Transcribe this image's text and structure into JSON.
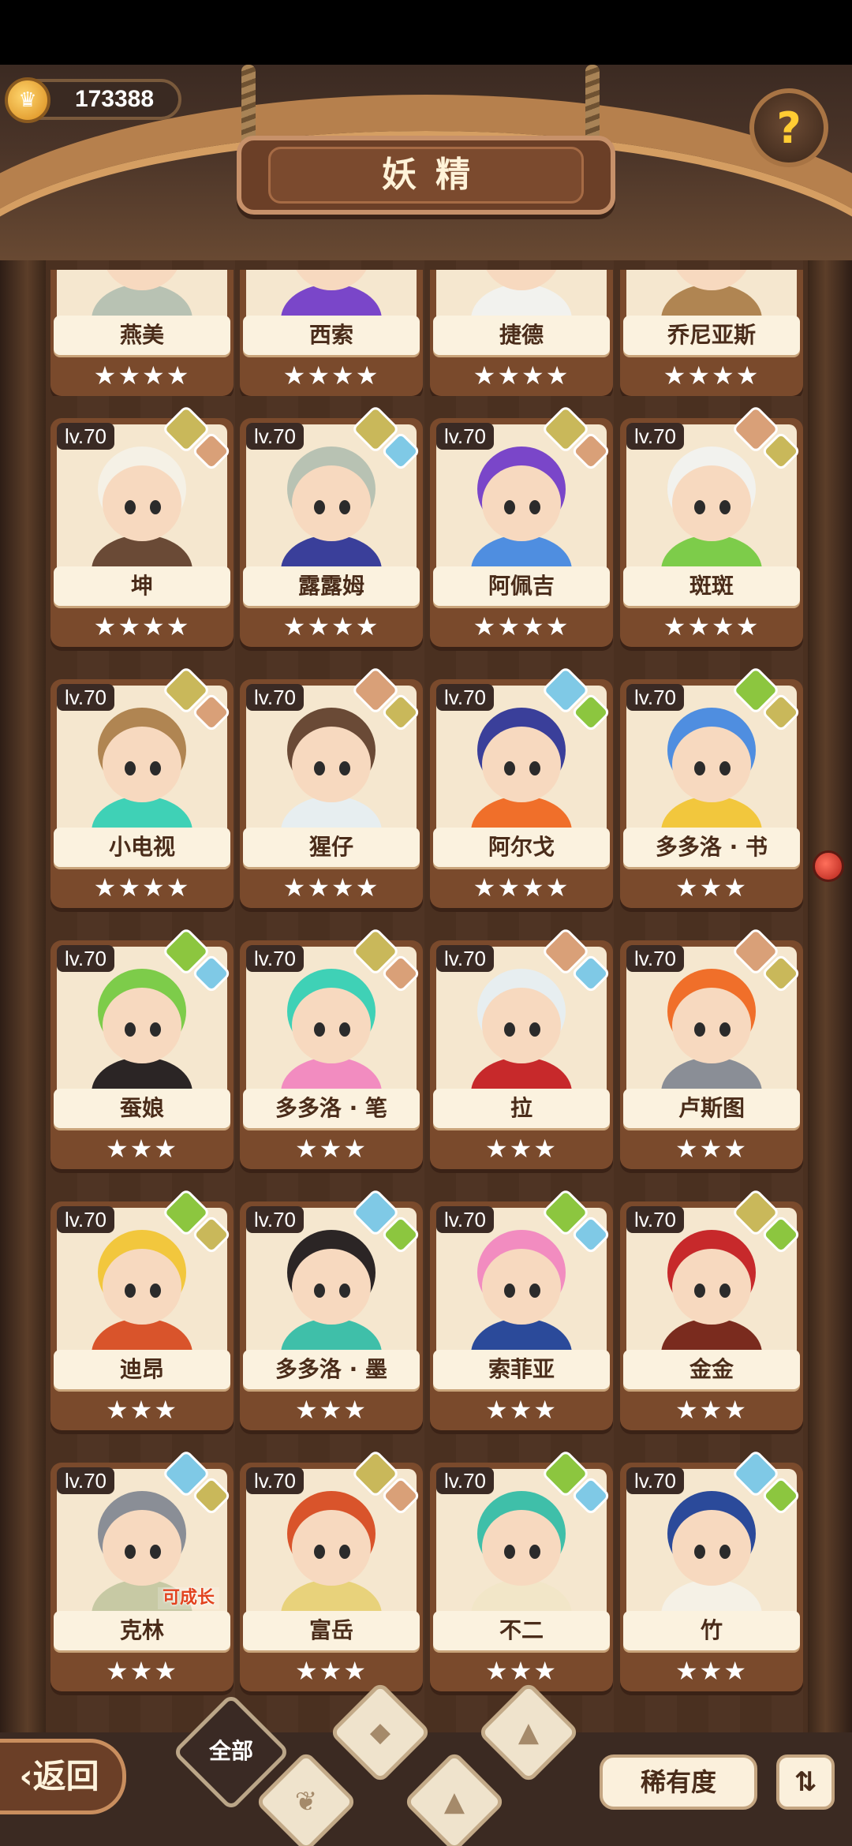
{
  "header": {
    "coins": "173388",
    "title": "妖精"
  },
  "bottom": {
    "back_label": "返回",
    "filter_all": "全部",
    "rarity_label": "稀有度"
  },
  "colors": {
    "element_leaf": "#8cc63f",
    "element_water": "#7fc9e6",
    "element_earth": "#c9b85a",
    "element_fire": "#d9a078"
  },
  "fairies": [
    {
      "name": "燕美",
      "level": "",
      "stars": "★★★★",
      "badges": []
    },
    {
      "name": "西索",
      "level": "",
      "stars": "★★★★",
      "badges": []
    },
    {
      "name": "捷德",
      "level": "",
      "stars": "★★★★",
      "badges": []
    },
    {
      "name": "乔尼亚斯",
      "level": "",
      "stars": "★★★★",
      "badges": []
    },
    {
      "name": "坤",
      "level": "lv.70",
      "stars": "★★★★",
      "badges": [
        "earth",
        "fire"
      ]
    },
    {
      "name": "露露姆",
      "level": "lv.70",
      "stars": "★★★★",
      "badges": [
        "earth",
        "water"
      ]
    },
    {
      "name": "阿佩吉",
      "level": "lv.70",
      "stars": "★★★★",
      "badges": [
        "earth",
        "fire"
      ]
    },
    {
      "name": "斑斑",
      "level": "lv.70",
      "stars": "★★★★",
      "badges": [
        "fire",
        "earth"
      ]
    },
    {
      "name": "小电视",
      "level": "lv.70",
      "stars": "★★★★",
      "badges": [
        "earth",
        "fire"
      ]
    },
    {
      "name": "猩仔",
      "level": "lv.70",
      "stars": "★★★★",
      "badges": [
        "fire",
        "earth"
      ]
    },
    {
      "name": "阿尔戈",
      "level": "lv.70",
      "stars": "★★★★",
      "badges": [
        "water",
        "leaf"
      ]
    },
    {
      "name": "多多洛 · 书",
      "level": "lv.70",
      "stars": "★★★",
      "badges": [
        "leaf",
        "earth"
      ]
    },
    {
      "name": "蚕娘",
      "level": "lv.70",
      "stars": "★★★",
      "badges": [
        "leaf",
        "water"
      ]
    },
    {
      "name": "多多洛 · 笔",
      "level": "lv.70",
      "stars": "★★★",
      "badges": [
        "earth",
        "fire"
      ]
    },
    {
      "name": "拉",
      "level": "lv.70",
      "stars": "★★★",
      "badges": [
        "fire",
        "water"
      ]
    },
    {
      "name": "卢斯图",
      "level": "lv.70",
      "stars": "★★★",
      "badges": [
        "fire",
        "earth"
      ]
    },
    {
      "name": "迪昂",
      "level": "lv.70",
      "stars": "★★★",
      "badges": [
        "leaf",
        "earth"
      ]
    },
    {
      "name": "多多洛 · 墨",
      "level": "lv.70",
      "stars": "★★★",
      "badges": [
        "water",
        "leaf"
      ]
    },
    {
      "name": "索菲亚",
      "level": "lv.70",
      "stars": "★★★",
      "badges": [
        "leaf",
        "water"
      ]
    },
    {
      "name": "金金",
      "level": "lv.70",
      "stars": "★★★",
      "badges": [
        "earth",
        "leaf"
      ]
    },
    {
      "name": "克林",
      "level": "lv.70",
      "stars": "★★★",
      "badges": [
        "water",
        "earth"
      ],
      "tag": "可成长"
    },
    {
      "name": "富岳",
      "level": "lv.70",
      "stars": "★★★",
      "badges": [
        "earth",
        "fire"
      ]
    },
    {
      "name": "不二",
      "level": "lv.70",
      "stars": "★★★",
      "badges": [
        "leaf",
        "water"
      ]
    },
    {
      "name": "竹",
      "level": "lv.70",
      "stars": "★★★",
      "badges": [
        "water",
        "leaf"
      ]
    }
  ]
}
